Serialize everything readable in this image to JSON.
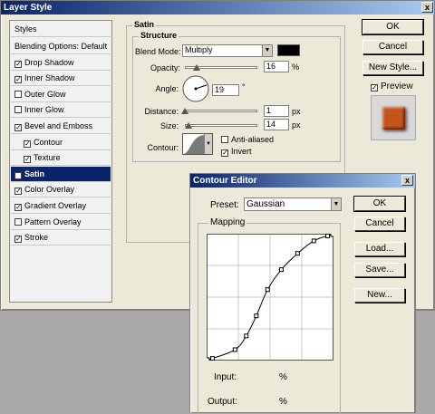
{
  "layer_style": {
    "title": "Layer Style",
    "close_glyph": "x",
    "styles_header": "Styles",
    "styles": [
      {
        "label": "Blending Options: Default",
        "checkbox": false,
        "checked": false,
        "indent": false,
        "selected": false
      },
      {
        "label": "Drop Shadow",
        "checkbox": true,
        "checked": true,
        "indent": false,
        "selected": false
      },
      {
        "label": "Inner Shadow",
        "checkbox": true,
        "checked": true,
        "indent": false,
        "selected": false
      },
      {
        "label": "Outer Glow",
        "checkbox": true,
        "checked": false,
        "indent": false,
        "selected": false
      },
      {
        "label": "Inner Glow",
        "checkbox": true,
        "checked": false,
        "indent": false,
        "selected": false
      },
      {
        "label": "Bevel and Emboss",
        "checkbox": true,
        "checked": true,
        "indent": false,
        "selected": false
      },
      {
        "label": "Contour",
        "checkbox": true,
        "checked": true,
        "indent": true,
        "selected": false
      },
      {
        "label": "Texture",
        "checkbox": true,
        "checked": true,
        "indent": true,
        "selected": false
      },
      {
        "label": "Satin",
        "checkbox": true,
        "checked": true,
        "indent": false,
        "selected": true
      },
      {
        "label": "Color Overlay",
        "checkbox": true,
        "checked": true,
        "indent": false,
        "selected": false
      },
      {
        "label": "Gradient Overlay",
        "checkbox": true,
        "checked": true,
        "indent": false,
        "selected": false
      },
      {
        "label": "Pattern Overlay",
        "checkbox": true,
        "checked": false,
        "indent": false,
        "selected": false
      },
      {
        "label": "Stroke",
        "checkbox": true,
        "checked": true,
        "indent": false,
        "selected": false
      }
    ],
    "satin": {
      "section_title": "Satin",
      "structure_title": "Structure",
      "blend_mode_label": "Blend Mode:",
      "blend_mode_value": "Multiply",
      "blend_color": "#000000",
      "opacity_label": "Opacity:",
      "opacity_value": "16",
      "opacity_unit": "%",
      "opacity_fraction": 0.16,
      "angle_label": "Angle:",
      "angle_value": "19",
      "angle_unit": "°",
      "distance_label": "Distance:",
      "distance_value": "1",
      "distance_unit": "px",
      "size_label": "Size:",
      "size_value": "14",
      "size_unit": "px",
      "contour_label": "Contour:",
      "anti_aliased_label": "Anti-aliased",
      "anti_aliased_checked": false,
      "invert_label": "Invert",
      "invert_checked": true
    },
    "buttons": {
      "ok": "OK",
      "cancel": "Cancel",
      "new_style": "New Style..."
    },
    "preview_label": "Preview",
    "preview_checked": true,
    "preview_color": "#c2541e"
  },
  "contour_editor": {
    "title": "Contour Editor",
    "close_glyph": "x",
    "preset_label": "Preset:",
    "preset_value": "Gaussian",
    "mapping_label": "Mapping",
    "input_label": "Input:",
    "input_unit": "%",
    "output_label": "Output:",
    "output_unit": "%",
    "buttons": {
      "ok": "OK",
      "cancel": "Cancel",
      "load": "Load...",
      "save": "Save...",
      "new": "New..."
    },
    "curve_points": [
      [
        0.0,
        0.0
      ],
      [
        0.04,
        0.01
      ],
      [
        0.22,
        0.08
      ],
      [
        0.31,
        0.19
      ],
      [
        0.39,
        0.35
      ],
      [
        0.48,
        0.56
      ],
      [
        0.59,
        0.72
      ],
      [
        0.72,
        0.85
      ],
      [
        0.85,
        0.95
      ],
      [
        0.96,
        0.99
      ],
      [
        1.0,
        1.0
      ]
    ]
  }
}
